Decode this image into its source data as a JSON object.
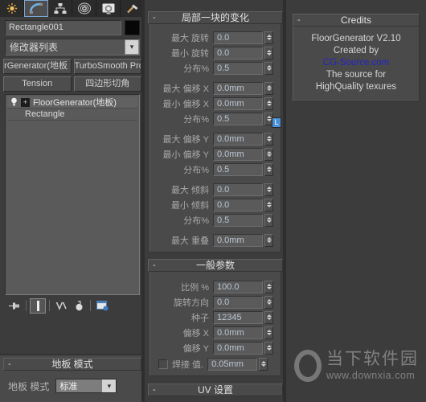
{
  "toolbar": {
    "items": [
      {
        "name": "create-tab-icon",
        "label": "Create"
      },
      {
        "name": "modify-tab-icon",
        "label": "Modify",
        "selected": true
      },
      {
        "name": "hierarchy-tab-icon",
        "label": "Hierarchy"
      },
      {
        "name": "motion-tab-icon",
        "label": "Motion"
      },
      {
        "name": "display-tab-icon",
        "label": "Display"
      },
      {
        "name": "utilities-tab-icon",
        "label": "Utilities"
      }
    ]
  },
  "object": {
    "name_value": "Rectangle001",
    "name_placeholder": "Rectangle001",
    "color_swatch": "#070707"
  },
  "modifier_list": {
    "label": "修改器列表",
    "arrow_icon": "chevron-down-icon"
  },
  "modifier_buttons": [
    {
      "label": "orGenerator(地板"
    },
    {
      "label": "TurboSmooth Pro"
    },
    {
      "label": "Tension"
    },
    {
      "label": "四边形切角"
    }
  ],
  "modifier_stack": [
    {
      "label": "FloorGenerator(地板)",
      "selected": true,
      "has_bulb": true,
      "has_plus": true
    },
    {
      "label": "Rectangle",
      "selected": false,
      "has_bulb": false,
      "has_plus": false
    }
  ],
  "stack_tools": [
    {
      "name": "pin-stack-icon",
      "active": false
    },
    {
      "name": "show-end-result-icon",
      "active": true
    },
    {
      "name": "make-unique-icon",
      "active": false
    },
    {
      "name": "remove-modifier-icon",
      "active": false
    },
    {
      "name": "configure-modifier-sets-icon",
      "active": false
    }
  ],
  "floor_mode_rollout": {
    "title": "地板 模式",
    "collapse_icon": "-",
    "label": "地板 模式",
    "value": "标准",
    "arrow_icon": "chevron-down-icon"
  },
  "local_variation_rollout": {
    "title": "局部一块的变化",
    "collapse_icon": "-",
    "rows": [
      {
        "label": "最大 旋转",
        "value": "0.0",
        "gap": false
      },
      {
        "label": "最小 旋转",
        "value": "0.0",
        "gap": false
      },
      {
        "label": "分布%",
        "value": "0.5",
        "gap": false
      },
      {
        "label": "最大 偏移 X",
        "value": "0.0mm",
        "gap": true
      },
      {
        "label": "最小 偏移 X",
        "value": "0.0mm",
        "gap": false
      },
      {
        "label": "分布%",
        "value": "0.5",
        "gap": false,
        "link": "L"
      },
      {
        "label": "最大 偏移 Y",
        "value": "0.0mm",
        "gap": true
      },
      {
        "label": "最小 偏移 Y",
        "value": "0.0mm",
        "gap": false
      },
      {
        "label": "分布%",
        "value": "0.5",
        "gap": false
      },
      {
        "label": "最大 倾斜",
        "value": "0.0",
        "gap": true
      },
      {
        "label": "最小 倾斜",
        "value": "0.0",
        "gap": false
      },
      {
        "label": "分布%",
        "value": "0.5",
        "gap": false
      },
      {
        "label": "最大 重叠",
        "value": "0.0mm",
        "gap": true
      }
    ]
  },
  "general_params_rollout": {
    "title": "一般参数",
    "collapse_icon": "-",
    "rows": [
      {
        "label": "比例 %",
        "value": "100.0",
        "gap": false
      },
      {
        "label": "旋转方向",
        "value": "0.0",
        "gap": false
      },
      {
        "label": "种子",
        "value": "12345",
        "gap": false
      },
      {
        "label": "偏移 X",
        "value": "0.0mm",
        "gap": false
      },
      {
        "label": "偏移 Y",
        "value": "0.0mm",
        "gap": false
      }
    ],
    "weld": {
      "label": "焊接 值.",
      "value": "0.05mm",
      "checked": false
    }
  },
  "uv_rollout": {
    "title": "UV 设置",
    "collapse_icon": "-"
  },
  "credits_rollout": {
    "title": "Credits",
    "collapse_icon": "-",
    "lines": [
      "FloorGenerator V2.10",
      "Created by"
    ],
    "link": "CG-Source.com",
    "lines2": [
      "The source for",
      "HighQuality texures"
    ]
  },
  "watermark": {
    "cn": "当下软件园",
    "url": "www.downxia.com"
  },
  "colors": {
    "panel_bg": "#4a4a4a",
    "window_bg": "#3c3c3c",
    "field_bg": "#5a5a5a",
    "field_text": "#b9c6d4",
    "label_text": "#a9a9a9",
    "accent_blue": "#4a90d9",
    "link_blue": "#2424c8"
  }
}
